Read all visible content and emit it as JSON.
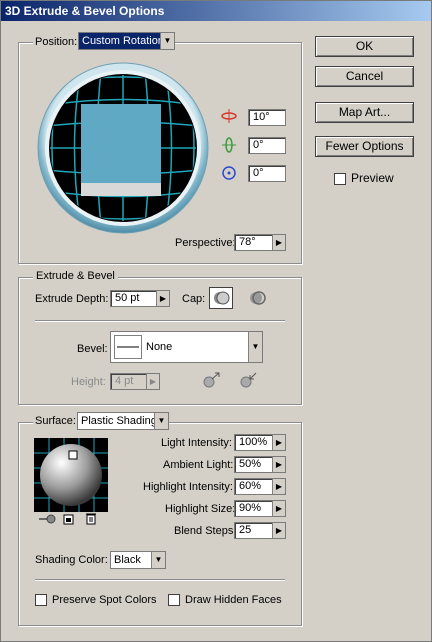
{
  "window": {
    "title": "3D Extrude & Bevel Options"
  },
  "buttons": {
    "ok": "OK",
    "cancel": "Cancel",
    "map_art": "Map Art...",
    "fewer_options": "Fewer Options"
  },
  "preview": {
    "label": "Preview",
    "checked": false
  },
  "position": {
    "label": "Position:",
    "value": "Custom Rotation",
    "rot_x": "10°",
    "rot_y": "0°",
    "rot_z": "0°",
    "perspective_label": "Perspective:",
    "perspective_value": "78°"
  },
  "extrude": {
    "group_label": "Extrude & Bevel",
    "depth_label": "Extrude Depth:",
    "depth_value": "50 pt",
    "cap_label": "Cap:",
    "bevel_label": "Bevel:",
    "bevel_value": "None",
    "height_label": "Height:",
    "height_value": "4 pt"
  },
  "surface": {
    "label": "Surface:",
    "value": "Plastic Shading",
    "rows": [
      {
        "label": "Light Intensity:",
        "value": "100%"
      },
      {
        "label": "Ambient Light:",
        "value": "50%"
      },
      {
        "label": "Highlight Intensity:",
        "value": "60%"
      },
      {
        "label": "Highlight Size:",
        "value": "90%"
      },
      {
        "label": "Blend Steps:",
        "value": "25"
      }
    ],
    "shading_color_label": "Shading Color:",
    "shading_color_value": "Black",
    "preserve_spot": "Preserve Spot Colors",
    "draw_hidden": "Draw Hidden Faces"
  },
  "colors": {
    "title_start": "#0a246a",
    "title_end": "#a6caf0",
    "cube_face": "#5fa9c4",
    "grid": "#1fa6b8"
  }
}
